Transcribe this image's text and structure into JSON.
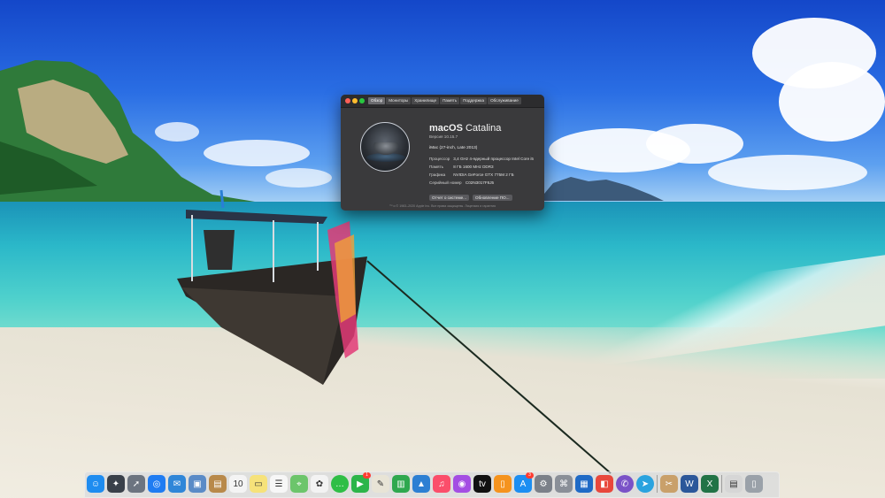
{
  "window": {
    "tabs": [
      "Обзор",
      "Мониторы",
      "Хранилище",
      "Память",
      "Поддержка",
      "Обслуживание"
    ],
    "active_tab": 0,
    "os_name_bold": "macOS",
    "os_name_light": "Catalina",
    "version": "Версия 10.15.7",
    "model": "iMac (27-inch, Late 2013)",
    "specs": [
      {
        "label": "Процессор",
        "value": "3,4 GHz 4-ядерный процессор Intel Core i5"
      },
      {
        "label": "Память",
        "value": "8 ГБ 1600 MHz DDR3"
      },
      {
        "label": "Графика",
        "value": "NVIDIA GeForce GTX 775M 2 ГБ"
      },
      {
        "label": "Серийный номер",
        "value": "C02N3017F8J5"
      }
    ],
    "buttons": {
      "system_report": "Отчет о системе...",
      "software_update": "Обновление ПО..."
    },
    "copyright": "™ и © 1983–2020 Apple Inc. Все права защищены. Лицензия и гарантия"
  },
  "dock": {
    "items": [
      {
        "name": "finder",
        "glyph": "☺",
        "bg": "#1e8cf0"
      },
      {
        "name": "launchpad",
        "glyph": "✦",
        "bg": "#39404a"
      },
      {
        "name": "rocket",
        "glyph": "➚",
        "bg": "#6c7480"
      },
      {
        "name": "safari",
        "glyph": "◎",
        "bg": "#1f7cf2"
      },
      {
        "name": "mail-letter",
        "glyph": "✉",
        "bg": "#2f86d8"
      },
      {
        "name": "photo-preview",
        "glyph": "▣",
        "bg": "#5a8bc7"
      },
      {
        "name": "contacts",
        "glyph": "▤",
        "bg": "#b8894a"
      },
      {
        "name": "calendar",
        "glyph": "10",
        "bg": "#f4f4f4",
        "dark": true
      },
      {
        "name": "notes",
        "glyph": "▭",
        "bg": "#f6e27a",
        "dark": true
      },
      {
        "name": "reminders",
        "glyph": "☰",
        "bg": "#f7f7f7",
        "dark": true
      },
      {
        "name": "maps",
        "glyph": "⌖",
        "bg": "#6cc56b"
      },
      {
        "name": "photos",
        "glyph": "✿",
        "bg": "#f3f3f3",
        "dark": true
      },
      {
        "name": "messages",
        "glyph": "…",
        "bg": "#2fbe46",
        "round": true
      },
      {
        "name": "facetime",
        "glyph": "▶",
        "bg": "#2cb54a",
        "badge": "1"
      },
      {
        "name": "text-edit",
        "glyph": "✎",
        "bg": "#e8e4d6",
        "dark": true
      },
      {
        "name": "numbers",
        "glyph": "▥",
        "bg": "#2fa84f"
      },
      {
        "name": "keynote",
        "glyph": "▲",
        "bg": "#2d7fd3"
      },
      {
        "name": "music",
        "glyph": "♫",
        "bg": "#fb4e6b"
      },
      {
        "name": "podcasts",
        "glyph": "◉",
        "bg": "#a44ee3"
      },
      {
        "name": "apple-tv",
        "glyph": "tv",
        "bg": "#111111"
      },
      {
        "name": "books",
        "glyph": "▯",
        "bg": "#f5931e"
      },
      {
        "name": "app-store",
        "glyph": "A",
        "bg": "#1c8ef2",
        "badge": "3"
      },
      {
        "name": "system-preferences",
        "glyph": "⚙",
        "bg": "#7b8089"
      },
      {
        "name": "script-editor",
        "glyph": "⌘",
        "bg": "#8a8f98"
      },
      {
        "name": "trello",
        "glyph": "▦",
        "bg": "#1f6ac6"
      },
      {
        "name": "flashcards",
        "glyph": "◧",
        "bg": "#e8473c"
      },
      {
        "name": "viber",
        "glyph": "✆",
        "bg": "#7a52c7",
        "round": true
      },
      {
        "name": "telegram",
        "glyph": "➤",
        "bg": "#2aa3df",
        "round": true
      },
      {
        "name": "sep1",
        "separator": true
      },
      {
        "name": "tools",
        "glyph": "✂",
        "bg": "#c9a06a"
      },
      {
        "name": "word",
        "glyph": "W",
        "bg": "#2b579a"
      },
      {
        "name": "excel",
        "glyph": "X",
        "bg": "#217346"
      },
      {
        "name": "sep2",
        "separator": true
      },
      {
        "name": "documents-stack",
        "glyph": "▤",
        "bg": "#d6d6d6",
        "dark": true
      },
      {
        "name": "trash",
        "glyph": "▯",
        "bg": "#9aa1a9"
      }
    ]
  }
}
